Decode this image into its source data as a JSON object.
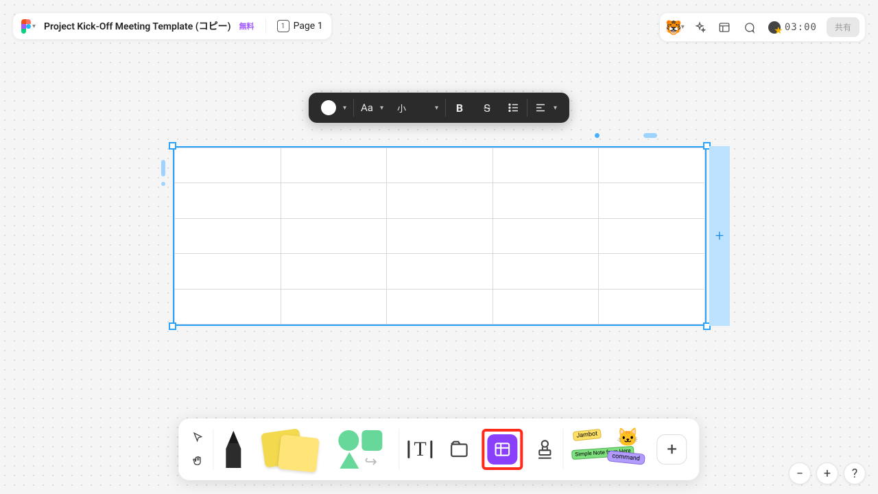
{
  "header": {
    "fileName": "Project Kick-Off Meeting Template (コピー)",
    "planBadge": "無料",
    "pageLabel": "Page 1",
    "pageNumberGlyph": "1"
  },
  "topRight": {
    "avatarEmoji": "🐯",
    "timer": "03:00",
    "shareLabel": "共有"
  },
  "floatToolbar": {
    "fontLabel": "Aa",
    "sizeLabel": "小",
    "boldGlyph": "B",
    "strikeGlyph": "S"
  },
  "bottomBar": {
    "textGlyph": "T",
    "plusGlyph": "+",
    "widgets": {
      "jambot": "Jambot",
      "note": "Simple Note\nfrom Here",
      "command": "command"
    }
  },
  "table": {
    "rows": 5,
    "cols": 5,
    "addGlyph": "+"
  },
  "zoom": {
    "minus": "−",
    "plus": "+",
    "help": "?"
  }
}
